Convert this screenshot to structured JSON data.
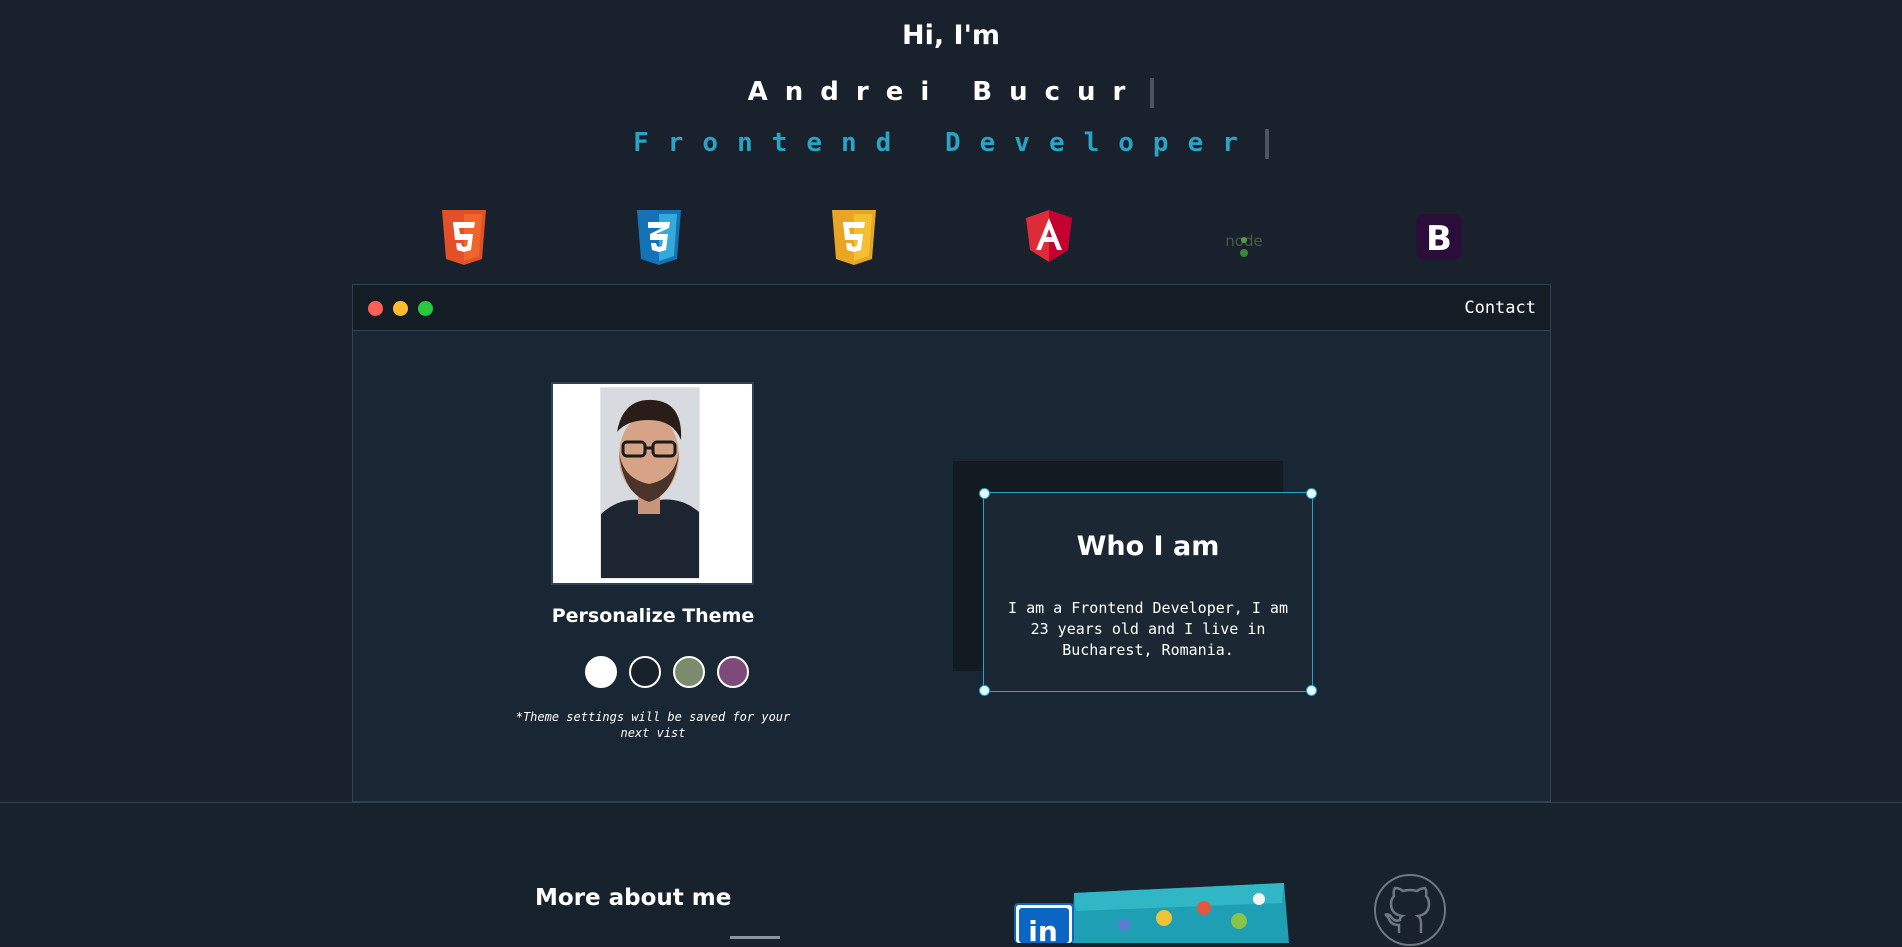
{
  "hero": {
    "greeting": "Hi, I'm",
    "name": "Andrei Bucur",
    "role": "Frontend Developer"
  },
  "tech_icons": [
    "html5-icon",
    "css3-icon",
    "javascript-icon",
    "angular-icon",
    "nodejs-icon",
    "bootstrap-icon"
  ],
  "window": {
    "contact_label": "Contact",
    "traffic_colors": [
      "#fe5f57",
      "#febc2e",
      "#28c840"
    ]
  },
  "theme": {
    "title": "Personalize Theme",
    "swatch_colors": [
      "#ffffff",
      "#18212c",
      "#7a8c6c",
      "#7d4a7a"
    ],
    "note": "*Theme settings will be saved for your next vist"
  },
  "about": {
    "title": "Who I am",
    "text": "I am a Frontend Developer, I am 23 years old and I live in Bucharest, Romania."
  },
  "more": {
    "title": "More about me"
  },
  "colors": {
    "accent": "#2aa3c4",
    "background": "#18212c"
  }
}
